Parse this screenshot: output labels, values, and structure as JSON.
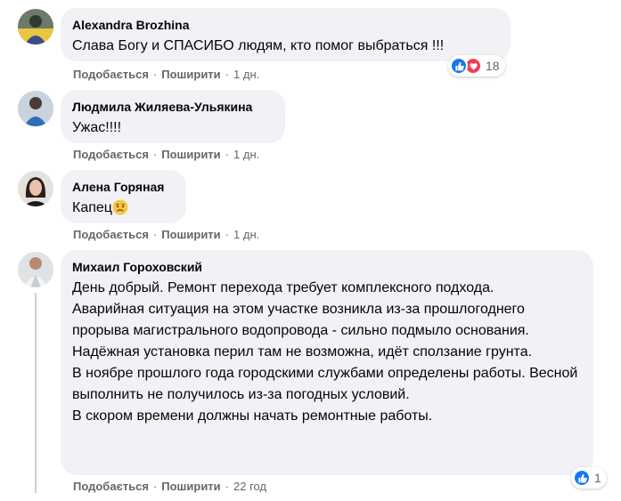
{
  "comments": [
    {
      "author": "Alexandra Brozhina",
      "text": "Слава Богу и СПАСИБО людям, кто помог выбраться !!!",
      "like": "Подобається",
      "share": "Поширити",
      "time": "1 дн.",
      "reaction_count": "18",
      "reaction_icons": [
        "like-icon",
        "love-icon"
      ]
    },
    {
      "author": "Людмила Жиляева-Ульякина",
      "text": "Ужас!!!!",
      "like": "Подобається",
      "share": "Поширити",
      "time": "1 дн."
    },
    {
      "author": "Алена Горяная",
      "text": "Капец",
      "emoji": "worried-face-emoji",
      "like": "Подобається",
      "share": "Поширити",
      "time": "1 дн."
    },
    {
      "author": "Михаил Гороховский",
      "text": "День добрый. Ремонт перехода требует комплексного подхода.\nАварийная ситуация на этом участке возникла из-за прошлогоднего прорыва магистрального водопровода - сильно подмыло основания.\nНадёжная установка перил там не возможна, идёт сползание грунта.\nВ ноябре прошлого года городскими службами определены работы. Весной выполнить не получилось из-за погодных условий.\nВ скором времени должны начать ремонтные работы.",
      "like": "Подобається",
      "share": "Поширити",
      "time": "22 год",
      "reaction_count": "1",
      "reaction_icons": [
        "like-icon"
      ]
    }
  ],
  "colors": {
    "bubble": "#f0f2f5",
    "meta_text": "#65676b",
    "like_blue": "#1877f2",
    "love_red": "#f33e58"
  }
}
